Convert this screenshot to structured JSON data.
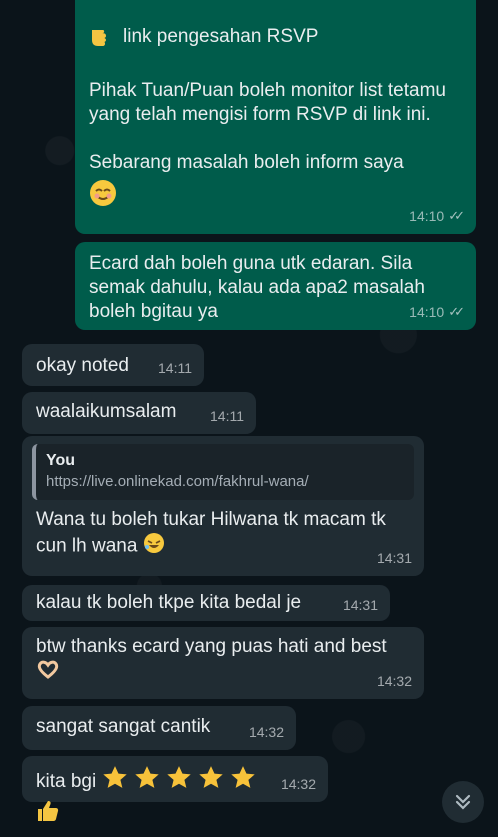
{
  "messages": {
    "m1": {
      "line1": "link pengesahan RSVP",
      "para1": "Pihak Tuan/Puan boleh monitor list tetamu yang telah mengisi form RSVP di link ini.",
      "para2": "Sebarang masalah boleh inform saya",
      "time": "14:10"
    },
    "m2": {
      "text": "Ecard dah boleh guna utk edaran. Sila semak dahulu, kalau ada apa2 masalah boleh bgitau ya",
      "time": "14:10"
    },
    "m3": {
      "text": "okay noted",
      "time": "14:11"
    },
    "m4": {
      "text": "waalaikumsalam",
      "time": "14:11"
    },
    "m5": {
      "quote_name": "You",
      "quote_text": "https://live.onlinekad.com/fakhrul-wana/",
      "text": "Wana tu boleh tukar Hilwana tk macam tk cun lh wana",
      "time": "14:31"
    },
    "m6": {
      "text": "kalau tk boleh tkpe kita bedal je",
      "time": "14:31"
    },
    "m7": {
      "text": "btw thanks ecard yang puas hati and best",
      "time": "14:32"
    },
    "m8": {
      "text": "sangat sangat cantik",
      "time": "14:32"
    },
    "m9": {
      "text": "kita bgi",
      "time": "14:32"
    }
  },
  "icons": {
    "pointing": "backhand-index-pointing-left-icon",
    "smile": "smiling-face-icon",
    "laugh": "rolling-laughing-icon",
    "heart_hands": "heart-hands-icon",
    "star": "star-icon",
    "thumbs": "thumbs-up-icon",
    "scroll": "chevron-double-down-icon"
  },
  "colors": {
    "background": "#0b141a",
    "outgoing_bubble": "#005c4b",
    "incoming_bubble": "#202c33"
  }
}
